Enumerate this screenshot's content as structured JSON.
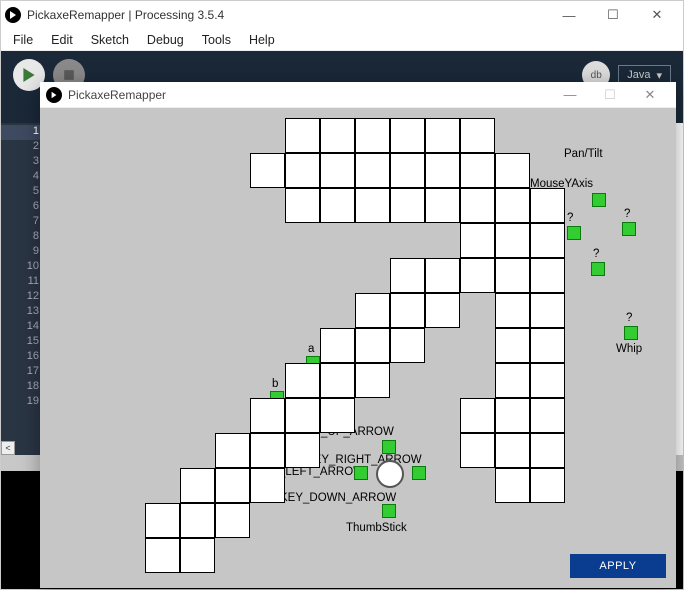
{
  "outer": {
    "title": "PickaxeRemapper | Processing 3.5.4",
    "menu": [
      "File",
      "Edit",
      "Sketch",
      "Debug",
      "Tools",
      "Help"
    ],
    "lang": "Java",
    "debug_badge": "db"
  },
  "gutter": {
    "lines": [
      "1",
      "2",
      "3",
      "4",
      "5",
      "6",
      "7",
      "8",
      "9",
      "10",
      "11",
      "12",
      "13",
      "14",
      "15",
      "16",
      "17",
      "18",
      "19"
    ],
    "highlighted": 0
  },
  "sketch": {
    "title": "PickaxeRemapper",
    "apply_label": "APPLY"
  },
  "nodes": {
    "pan_tilt": "Pan/Tilt",
    "mouse_y": "MouseYAxis",
    "q1": "?",
    "q2": "?",
    "q3": "?",
    "whip_q": "?",
    "whip": "Whip",
    "a": "a",
    "b": "b",
    "up": "KEY_UP_ARROW",
    "right": "KEY_RIGHT_ARROW",
    "left": "KEY_LEFT_ARROW",
    "down": "KEY_DOWN_ARROW",
    "thumb": "ThumbStick"
  },
  "grid": {
    "cell": 35,
    "cells": [
      [
        7,
        0
      ],
      [
        8,
        0
      ],
      [
        9,
        0
      ],
      [
        10,
        0
      ],
      [
        11,
        0
      ],
      [
        12,
        0
      ],
      [
        6,
        1
      ],
      [
        7,
        1
      ],
      [
        8,
        1
      ],
      [
        9,
        1
      ],
      [
        10,
        1
      ],
      [
        11,
        1
      ],
      [
        12,
        1
      ],
      [
        13,
        1
      ],
      [
        7,
        2
      ],
      [
        8,
        2
      ],
      [
        9,
        2
      ],
      [
        10,
        2
      ],
      [
        11,
        2
      ],
      [
        12,
        2
      ],
      [
        13,
        2
      ],
      [
        14,
        2
      ],
      [
        12,
        3
      ],
      [
        13,
        3
      ],
      [
        14,
        3
      ],
      [
        10,
        4
      ],
      [
        11,
        4
      ],
      [
        12,
        4
      ],
      [
        13,
        4
      ],
      [
        14,
        4
      ],
      [
        9,
        5
      ],
      [
        10,
        5
      ],
      [
        11,
        5
      ],
      [
        13,
        5
      ],
      [
        14,
        5
      ],
      [
        8,
        6
      ],
      [
        9,
        6
      ],
      [
        10,
        6
      ],
      [
        13,
        6
      ],
      [
        14,
        6
      ],
      [
        7,
        7
      ],
      [
        8,
        7
      ],
      [
        9,
        7
      ],
      [
        13,
        7
      ],
      [
        14,
        7
      ],
      [
        6,
        8
      ],
      [
        7,
        8
      ],
      [
        8,
        8
      ],
      [
        12,
        8
      ],
      [
        13,
        8
      ],
      [
        14,
        8
      ],
      [
        5,
        9
      ],
      [
        6,
        9
      ],
      [
        7,
        9
      ],
      [
        12,
        9
      ],
      [
        13,
        9
      ],
      [
        14,
        9
      ],
      [
        4,
        10
      ],
      [
        5,
        10
      ],
      [
        6,
        10
      ],
      [
        13,
        10
      ],
      [
        14,
        10
      ],
      [
        3,
        11
      ],
      [
        4,
        11
      ],
      [
        5,
        11
      ],
      [
        3,
        12
      ],
      [
        4,
        12
      ]
    ]
  }
}
